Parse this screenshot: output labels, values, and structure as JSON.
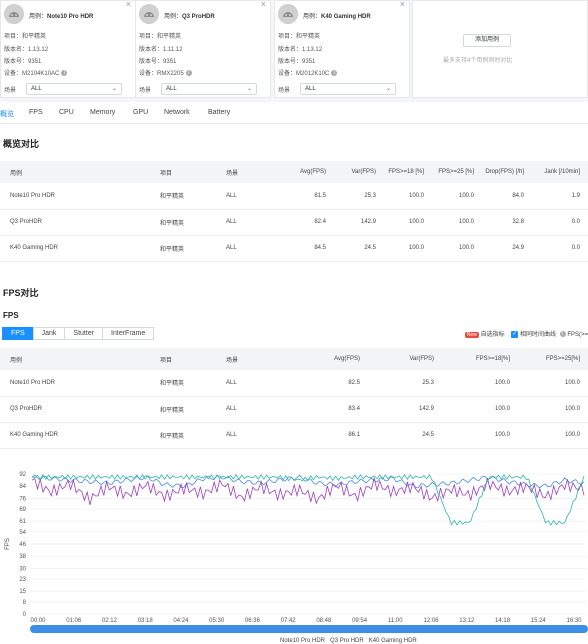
{
  "devices": [
    {
      "user_label": "用例：",
      "user": "Note10 Pro HDR",
      "project_label": "项目：",
      "project": "和平精英",
      "version_label": "版本名：",
      "version": "1.13.12",
      "build_label": "版本号：",
      "build": "9351",
      "device_label": "设备：",
      "device": "M2104K10AC",
      "scene_label": "场景",
      "scene": "ALL"
    },
    {
      "user_label": "用例：",
      "user": "Q3 ProHDR",
      "project_label": "项目：",
      "project": "和平精英",
      "version_label": "版本名：",
      "version": "1.11.12",
      "build_label": "版本号：",
      "build": "9351",
      "device_label": "设备：",
      "device": "RMX2205",
      "scene_label": "场景",
      "scene": "ALL"
    },
    {
      "user_label": "用例：",
      "user": "K40 Gaming HDR",
      "project_label": "项目：",
      "project": "和平精英",
      "version_label": "版本名：",
      "version": "1.13.12",
      "build_label": "版本号：",
      "build": "9351",
      "device_label": "设备：",
      "device": "M2012K10C",
      "scene_label": "场景",
      "scene": "ALL"
    }
  ],
  "add_card": {
    "button": "添加用例",
    "hint": "最多支持4个用例同时对比"
  },
  "tabs": [
    "概览",
    "FPS",
    "CPU",
    "Memory",
    "GPU",
    "Network",
    "Battery"
  ],
  "overview": {
    "title": "概览对比",
    "headers": [
      "用例",
      "项目",
      "场景",
      "Avg(FPS)",
      "Var(FPS)",
      "FPS>=18 [%]",
      "FPS>=25 [%]",
      "Drop(FPS) [/h]",
      "Jank [/10min]"
    ],
    "rows": [
      [
        "Note10 Pro HDR",
        "和平精英",
        "ALL",
        "81.5",
        "25.3",
        "100.0",
        "100.0",
        "84.0",
        "1.9"
      ],
      [
        "Q3 ProHDR",
        "和平精英",
        "ALL",
        "82.4",
        "142.9",
        "100.0",
        "100.0",
        "32.8",
        "0.0"
      ],
      [
        "K40 Gaming HDR",
        "和平精英",
        "ALL",
        "84.5",
        "24.5",
        "100.0",
        "100.0",
        "24.9",
        "0.0"
      ]
    ]
  },
  "fps_section": {
    "title": "FPS对比",
    "subtitle": "FPS",
    "subtabs": [
      "FPS",
      "Jank",
      "Stutter",
      "InterFrame"
    ],
    "new_badge": "New",
    "tool1": "自选指标",
    "tool2": "相同时间曲线",
    "tool3": "FPS(>=",
    "headers": [
      "用例",
      "项目",
      "场景",
      "Avg(FPS)",
      "Var(FPS)",
      "FPS>=18[%]",
      "FPS>=25[%]"
    ],
    "rows": [
      [
        "Note10 Pro HDR",
        "和平精英",
        "ALL",
        "82.5",
        "25.3",
        "100.0",
        "100.0"
      ],
      [
        "Q3 ProHDR",
        "和平精英",
        "ALL",
        "83.4",
        "142.9",
        "100.0",
        "100.0"
      ],
      [
        "K40 Gaming HDR",
        "和平精英",
        "ALL",
        "86.1",
        "24.5",
        "100.0",
        "100.0"
      ]
    ]
  },
  "chart_data": {
    "type": "line",
    "ylabel": "FPS",
    "yticks": [
      0,
      8,
      15,
      23,
      30,
      38,
      46,
      54,
      61,
      69,
      76,
      84,
      92
    ],
    "ylim": [
      0,
      92
    ],
    "xticks": [
      "00:00",
      "01:06",
      "02:12",
      "03:18",
      "04:24",
      "05:30",
      "06:36",
      "07:42",
      "08:48",
      "09:54",
      "11:00",
      "12:06",
      "13:12",
      "14:18",
      "15:24",
      "16:30"
    ],
    "series": [
      {
        "name": "Note10 Pro HDR",
        "color": "#4a8fd8",
        "values": [
          90,
          89,
          88,
          87,
          86,
          88,
          90,
          85,
          84,
          89,
          90,
          87,
          86,
          88,
          90,
          86,
          85,
          87,
          88,
          89,
          84,
          85,
          86,
          88,
          90,
          87,
          85,
          84,
          88,
          86
        ]
      },
      {
        "name": "Q3 Pro HDR",
        "color": "#9b3fbf",
        "values": [
          88,
          80,
          86,
          75,
          84,
          78,
          85,
          77,
          83,
          79,
          86,
          76,
          84,
          78,
          82,
          75,
          85,
          77,
          86,
          80,
          84,
          76,
          82,
          78,
          86,
          80,
          84,
          77,
          85,
          82
        ]
      },
      {
        "name": "K40 Gaming HDR",
        "color": "#2fb5a8",
        "values": [
          90,
          90,
          90,
          90,
          90,
          90,
          90,
          90,
          90,
          90,
          90,
          90,
          90,
          90,
          88,
          90,
          89,
          90,
          90,
          90,
          90,
          90,
          60,
          60,
          90,
          90,
          90,
          60,
          60,
          90
        ]
      }
    ]
  },
  "scroll_progress": 1.0,
  "legend_labels": [
    "Note10 Pro HDR",
    "Q3 Pro HDR",
    "K40 Gaming HDR"
  ]
}
